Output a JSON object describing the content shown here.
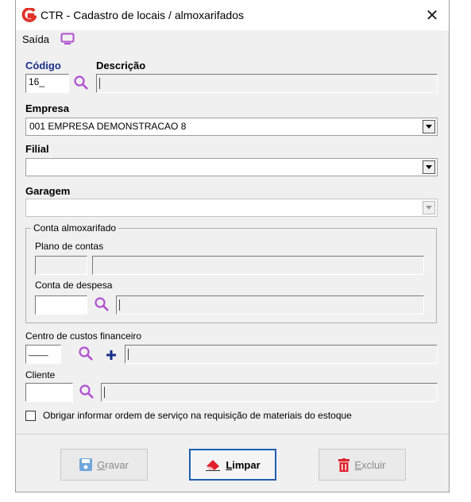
{
  "window": {
    "title": "CTR - Cadastro de locais / almoxarifados",
    "close_label": "✕"
  },
  "menu": {
    "saida_label": "Saída",
    "monitor_icon": "monitor-icon"
  },
  "form": {
    "codigo": {
      "label": "Código",
      "value": "16_"
    },
    "descricao": {
      "label": "Descrição",
      "value": ""
    },
    "empresa": {
      "label": "Empresa",
      "value": "001 EMPRESA DEMONSTRACAO 8"
    },
    "filial": {
      "label": "Filial",
      "value": ""
    },
    "garagem": {
      "label": "Garagem",
      "value": ""
    },
    "conta_group": {
      "title": "Conta almoxarifado",
      "plano_label": "Plano de contas",
      "despesa_label": "Conta de despesa"
    },
    "centro": {
      "label": "Centro de custos financeiro",
      "value": "____"
    },
    "cliente": {
      "label": "Cliente",
      "value": ""
    },
    "obrigar_label": "Obrigar informar ordem de serviço na requisição de materiais do estoque"
  },
  "buttons": {
    "gravar": {
      "hotkey": "G",
      "rest": "ravar"
    },
    "limpar": {
      "hotkey": "L",
      "rest": "impar"
    },
    "excluir": {
      "hotkey": "E",
      "rest": "xcluir"
    }
  },
  "colors": {
    "accent": "#1a2e8c",
    "search_icon": "#b04fd0",
    "logo": "#e0322a"
  }
}
